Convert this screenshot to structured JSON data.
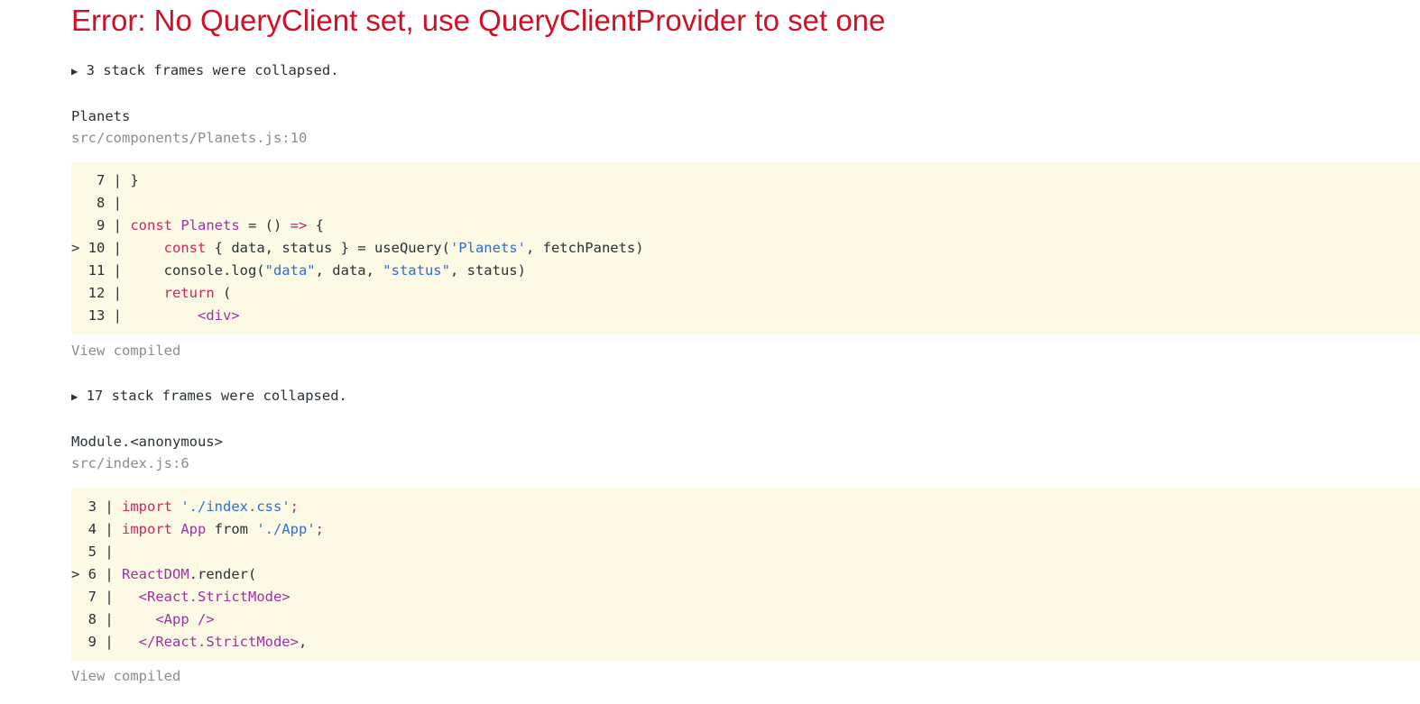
{
  "error_title": "Error: No QueryClient set, use QueryClientProvider to set one",
  "colors": {
    "error_red": "#ce1126",
    "code_bg": "#fcf9e4",
    "muted": "#878e91"
  },
  "frames": [
    {
      "collapsed_text": "3 stack frames were collapsed.",
      "function_name": "Planets",
      "location": "src/components/Planets.js:10",
      "code_lines": [
        {
          "marker": "  ",
          "num": " 7",
          "code": [
            {
              "t": "}",
              "c": ""
            }
          ]
        },
        {
          "marker": "  ",
          "num": " 8",
          "code": []
        },
        {
          "marker": "  ",
          "num": " 9",
          "code": [
            {
              "t": "const",
              "c": "kw"
            },
            {
              "t": " ",
              "c": ""
            },
            {
              "t": "Planets",
              "c": "cl"
            },
            {
              "t": " = () ",
              "c": ""
            },
            {
              "t": "=>",
              "c": "pu"
            },
            {
              "t": " {",
              "c": ""
            }
          ]
        },
        {
          "marker": "> ",
          "num": "10",
          "code": [
            {
              "t": "    ",
              "c": ""
            },
            {
              "t": "const",
              "c": "kw"
            },
            {
              "t": " { data, status } = useQuery(",
              "c": ""
            },
            {
              "t": "'Planets'",
              "c": "str"
            },
            {
              "t": ", fetchPanets)",
              "c": ""
            }
          ]
        },
        {
          "marker": "  ",
          "num": "11",
          "code": [
            {
              "t": "    console.log(",
              "c": ""
            },
            {
              "t": "\"data\"",
              "c": "str"
            },
            {
              "t": ", data, ",
              "c": ""
            },
            {
              "t": "\"status\"",
              "c": "str"
            },
            {
              "t": ", status)",
              "c": ""
            }
          ]
        },
        {
          "marker": "  ",
          "num": "12",
          "code": [
            {
              "t": "    ",
              "c": ""
            },
            {
              "t": "return",
              "c": "kw"
            },
            {
              "t": " (",
              "c": ""
            }
          ]
        },
        {
          "marker": "  ",
          "num": "13",
          "code": [
            {
              "t": "        ",
              "c": ""
            },
            {
              "t": "<div>",
              "c": "cl"
            }
          ]
        }
      ],
      "view_compiled": "View compiled"
    },
    {
      "collapsed_text": "17 stack frames were collapsed.",
      "function_name": "Module.<anonymous>",
      "location": "src/index.js:6",
      "code_lines": [
        {
          "marker": "  ",
          "num": "3",
          "code": [
            {
              "t": "import",
              "c": "kw"
            },
            {
              "t": " ",
              "c": ""
            },
            {
              "t": "'./index.css'",
              "c": "str"
            },
            {
              "t": ";",
              "c": "pu"
            }
          ]
        },
        {
          "marker": "  ",
          "num": "4",
          "code": [
            {
              "t": "import",
              "c": "kw"
            },
            {
              "t": " ",
              "c": ""
            },
            {
              "t": "App",
              "c": "cl"
            },
            {
              "t": " from ",
              "c": ""
            },
            {
              "t": "'./App'",
              "c": "str"
            },
            {
              "t": ";",
              "c": "pu"
            }
          ]
        },
        {
          "marker": "  ",
          "num": "5",
          "code": []
        },
        {
          "marker": "> ",
          "num": "6",
          "code": [
            {
              "t": "ReactDOM",
              "c": "cl"
            },
            {
              "t": ".render(",
              "c": ""
            }
          ]
        },
        {
          "marker": "  ",
          "num": "7",
          "code": [
            {
              "t": "  ",
              "c": ""
            },
            {
              "t": "<React.StrictMode>",
              "c": "cl"
            }
          ]
        },
        {
          "marker": "  ",
          "num": "8",
          "code": [
            {
              "t": "    ",
              "c": ""
            },
            {
              "t": "<App />",
              "c": "cl"
            }
          ]
        },
        {
          "marker": "  ",
          "num": "9",
          "code": [
            {
              "t": "  ",
              "c": ""
            },
            {
              "t": "</React.StrictMode>",
              "c": "cl"
            },
            {
              "t": ",",
              "c": ""
            }
          ]
        }
      ],
      "view_compiled": "View compiled"
    }
  ]
}
